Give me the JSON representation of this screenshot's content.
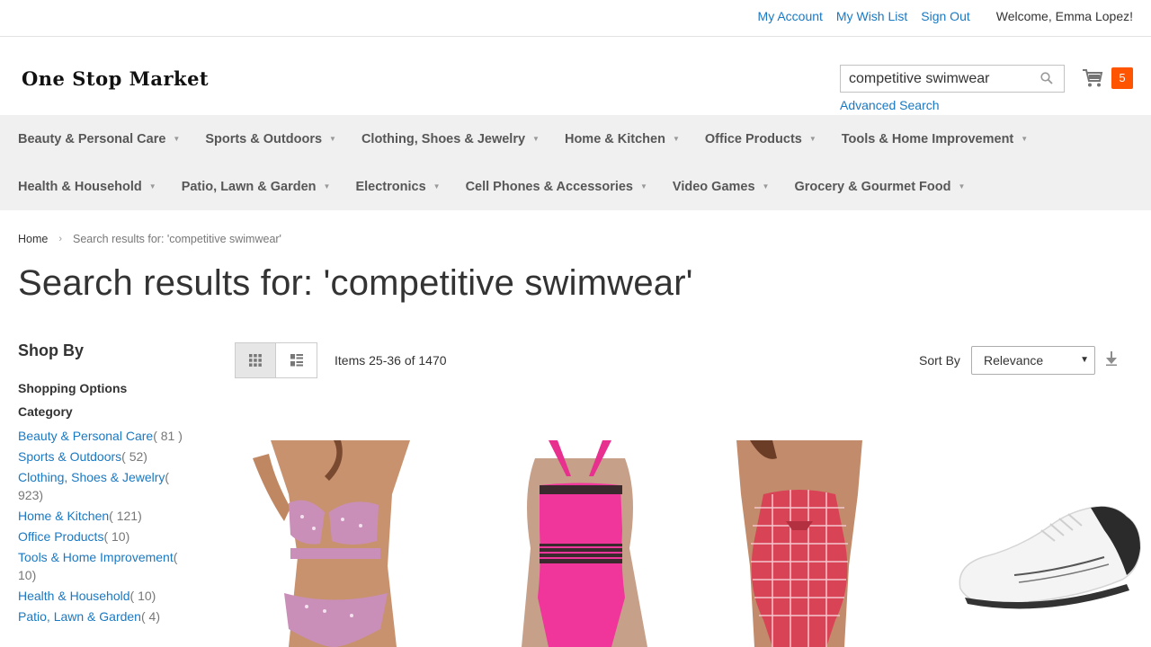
{
  "top_links": {
    "my_account": "My Account",
    "wish_list": "My Wish List",
    "sign_out": "Sign Out",
    "welcome": "Welcome, Emma Lopez!"
  },
  "logo": "One Stop Market",
  "search": {
    "value": "competitive swimwear",
    "advanced": "Advanced Search"
  },
  "cart": {
    "count": "5"
  },
  "nav": {
    "row1": [
      "Beauty & Personal Care",
      "Sports & Outdoors",
      "Clothing, Shoes & Jewelry",
      "Home & Kitchen",
      "Office Products",
      "Tools & Home Improvement"
    ],
    "row2": [
      "Health & Household",
      "Patio, Lawn & Garden",
      "Electronics",
      "Cell Phones & Accessories",
      "Video Games",
      "Grocery & Gourmet Food"
    ]
  },
  "breadcrumbs": {
    "home": "Home",
    "current": "Search results for: 'competitive swimwear'"
  },
  "page_title": "Search results for: 'competitive swimwear'",
  "sidebar": {
    "shop_by": "Shop By",
    "shopping_options": "Shopping Options",
    "category_title": "Category",
    "categories": [
      {
        "label": "Beauty & Personal Care",
        "count": "( 81 )"
      },
      {
        "label": "Sports & Outdoors",
        "count": "( 52)"
      },
      {
        "label": "Clothing, Shoes & Jewelry",
        "count": "( 923)"
      },
      {
        "label": "Home & Kitchen",
        "count": "( 121)"
      },
      {
        "label": "Office Products",
        "count": "( 10)"
      },
      {
        "label": "Tools & Home Improvement",
        "count": "( 10)"
      },
      {
        "label": "Health & Household",
        "count": "( 10)"
      },
      {
        "label": "Patio, Lawn & Garden",
        "count": "( 4)"
      }
    ]
  },
  "toolbar": {
    "amount": "Items 25-36 of 1470",
    "sort_label": "Sort By",
    "sort_value": "Relevance"
  },
  "colors": {
    "link": "#1979c3",
    "cart_badge": "#ff5501",
    "nav_bg": "#f0f0f0"
  }
}
